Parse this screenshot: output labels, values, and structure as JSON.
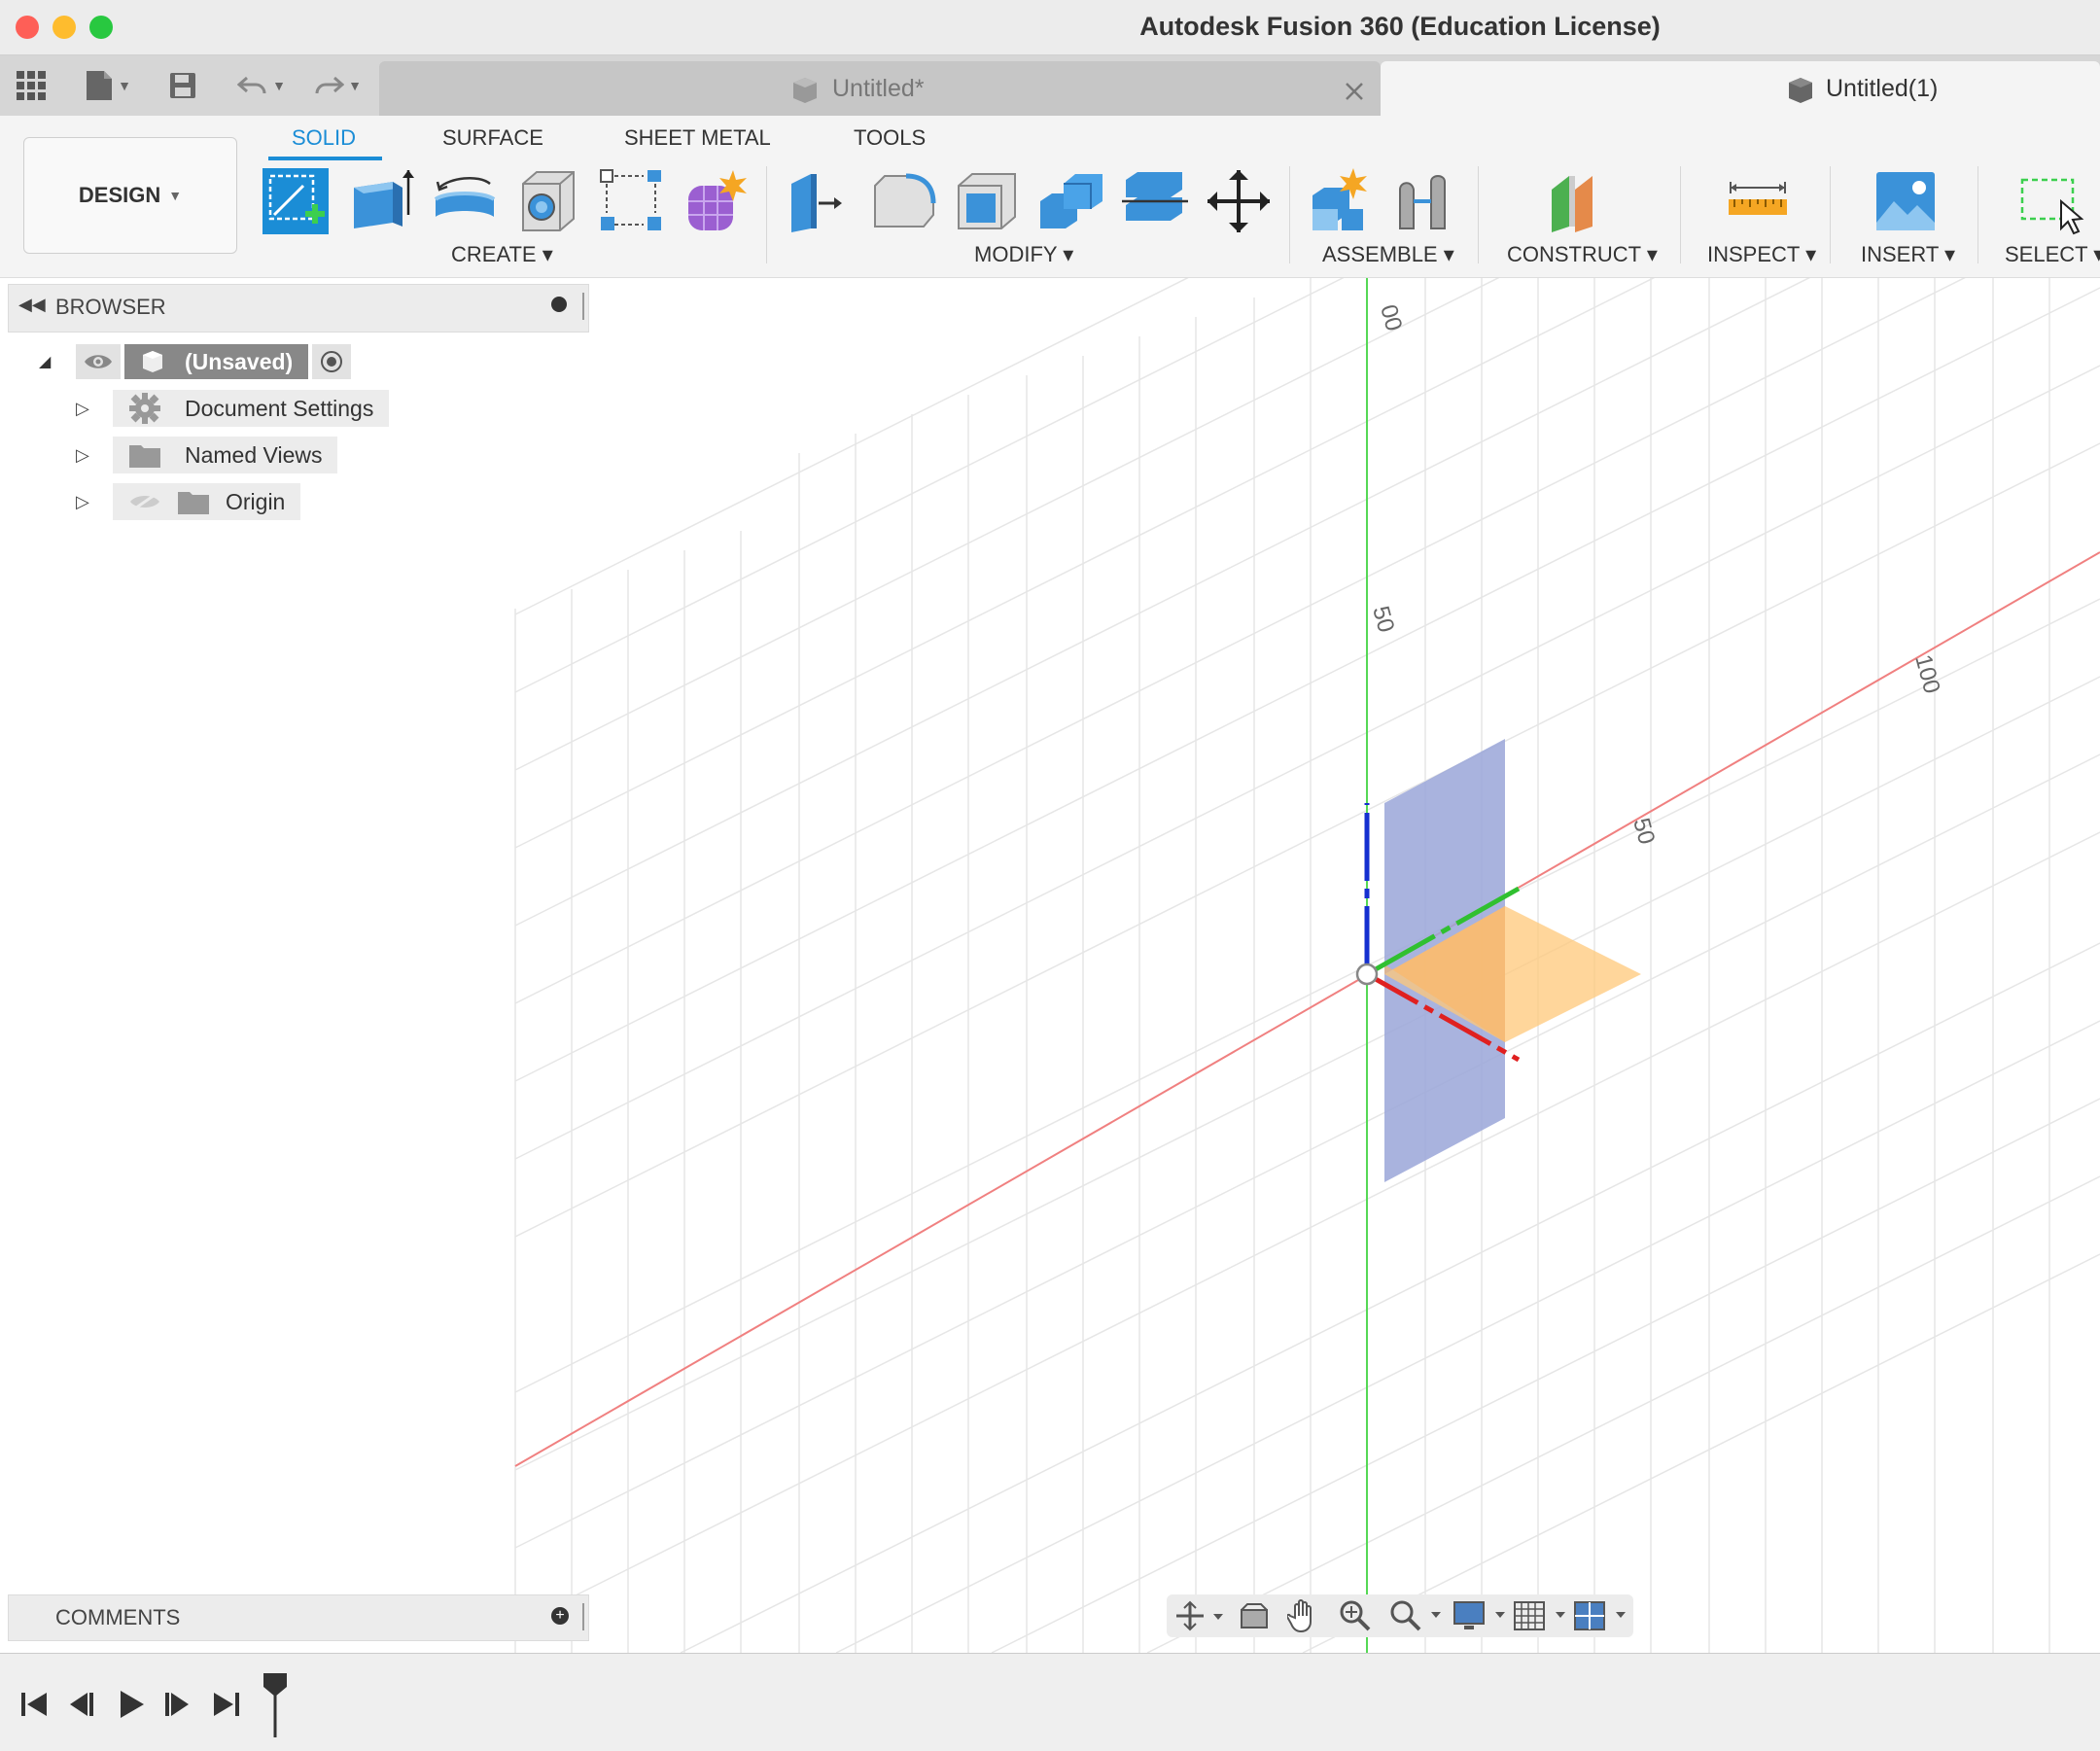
{
  "window": {
    "title": "Autodesk Fusion 360 (Education License)"
  },
  "tabs": [
    {
      "label": "Untitled*"
    },
    {
      "label": "Untitled(1)"
    }
  ],
  "toolbar": {
    "workspace_button": "DESIGN",
    "workspace_tabs": [
      "SOLID",
      "SURFACE",
      "SHEET METAL",
      "TOOLS"
    ],
    "groups": [
      "CREATE",
      "MODIFY",
      "ASSEMBLE",
      "CONSTRUCT",
      "INSPECT",
      "INSERT",
      "SELECT"
    ]
  },
  "browser": {
    "title": "BROWSER",
    "root": "(Unsaved)",
    "items": [
      "Document Settings",
      "Named Views",
      "Origin"
    ]
  },
  "comments": {
    "title": "COMMENTS"
  },
  "viewport": {
    "axis_labels": [
      "00",
      "50",
      "50",
      "100"
    ]
  },
  "colors": {
    "accent": "#1b8dd6",
    "x_axis": "#e02020",
    "y_axis": "#30c030",
    "z_axis": "#1530d0"
  }
}
